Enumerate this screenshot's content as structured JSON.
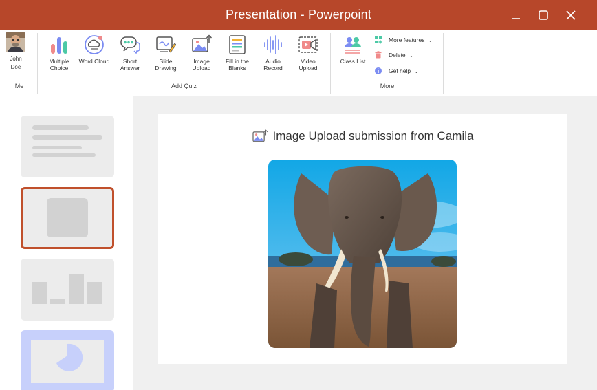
{
  "window": {
    "title": "Presentation - Powerpoint",
    "controls": [
      "minimize",
      "maximize",
      "close"
    ]
  },
  "ribbon": {
    "me_group": {
      "user_name": "John Doe",
      "label": "Me"
    },
    "add_quiz_group": {
      "label": "Add Quiz",
      "buttons": [
        {
          "label": "Multiple Choice",
          "icon": "bar-chart-icon"
        },
        {
          "label": "Word Cloud",
          "icon": "word-cloud-icon"
        },
        {
          "label": "Short Answer",
          "icon": "speech-bubbles-icon"
        },
        {
          "label": "Slide Drawing",
          "icon": "slide-drawing-icon"
        },
        {
          "label": "Image Upload",
          "icon": "image-upload-icon"
        },
        {
          "label": "Fill in the Blanks",
          "icon": "fill-blanks-icon"
        },
        {
          "label": "Audio Record",
          "icon": "audio-wave-icon"
        },
        {
          "label": "Video Upload",
          "icon": "video-upload-icon"
        }
      ]
    },
    "more_group": {
      "label": "More",
      "class_list": {
        "label": "Class List",
        "icon": "people-icon"
      },
      "menu": [
        {
          "label": "More features",
          "icon": "grid-plus-icon"
        },
        {
          "label": "Delete",
          "icon": "trash-icon"
        },
        {
          "label": "Get help",
          "icon": "info-icon"
        }
      ]
    }
  },
  "slides_panel": {
    "slides": [
      "text-layout",
      "image-layout",
      "bar-chart-layout",
      "pie-chart-layout"
    ],
    "selected_index": 1
  },
  "main": {
    "heading": "Image Upload submission from Camila",
    "heading_icon": "image-upload-icon",
    "image_subject": "elephant"
  },
  "colors": {
    "title_bar": "#b7472a",
    "selected_slide_border": "#c0502c",
    "pie_slide_bg": "#c7d0fb"
  }
}
